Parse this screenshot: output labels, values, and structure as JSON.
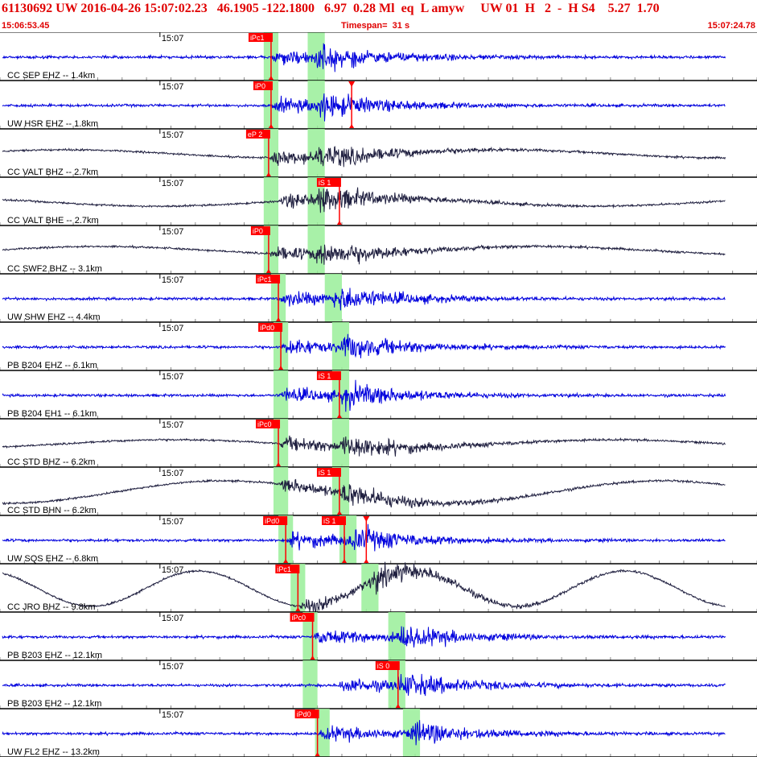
{
  "header": {
    "title": "61130692 UW 2016-04-26 15:07:02.23   46.1905 -122.1800   6.97  0.28 Ml  eq  L amyw     UW 01  H   2  -  H S4    5.27  1.70",
    "start_time": "15:06:53.45",
    "timespan_label": "Timespan=  31 s",
    "end_time": "15:07:24.78"
  },
  "colors": {
    "title": "#e00000",
    "pick_flag": "#ff0000",
    "pick_line": "#ff0000",
    "window_band": "#99ee99",
    "trace_vertical_velocity": "#0000dd",
    "trace_broadband": "#202040",
    "grid": "#d0d0d0",
    "panel_border": "#000000"
  },
  "chart_data": {
    "type": "line",
    "time_window": {
      "start": "15:06:53.45",
      "end": "15:07:24.78",
      "span_s": 31
    },
    "panel_time_label": "15:07",
    "panels": [
      {
        "label": "CC SEP EHZ -- 1.4km",
        "color": "trace_vertical_velocity",
        "picks": [
          {
            "label": "iPc1",
            "t": 11.1,
            "kind": "P"
          }
        ],
        "bands": [
          [
            10.8,
            11.4
          ],
          [
            12.6,
            13.3
          ]
        ]
      },
      {
        "label": "UW HSR EHZ -- 1.8km",
        "color": "trace_vertical_velocity",
        "picks": [
          {
            "label": "iP0",
            "t": 11.1,
            "kind": "P"
          },
          {
            "label": "",
            "t": 14.4,
            "kind": "S"
          }
        ],
        "bands": [
          [
            10.8,
            11.4
          ],
          [
            12.6,
            13.3
          ]
        ]
      },
      {
        "label": "CC VALT BHZ -- 2.7km",
        "color": "trace_broadband",
        "picks": [
          {
            "label": "eP 2",
            "t": 11.0,
            "kind": "P"
          }
        ],
        "bands": [
          [
            10.8,
            11.4
          ],
          [
            12.6,
            13.3
          ]
        ]
      },
      {
        "label": "CC VALT BHE -- 2.7km",
        "color": "trace_broadband",
        "picks": [
          {
            "label": "iS 1",
            "t": 13.9,
            "kind": "S"
          }
        ],
        "bands": [
          [
            10.8,
            11.4
          ],
          [
            12.6,
            13.3
          ]
        ]
      },
      {
        "label": "CC SWF2 BHZ -- 3.1km",
        "color": "trace_broadband",
        "picks": [
          {
            "label": "iP0",
            "t": 11.0,
            "kind": "P"
          }
        ],
        "bands": [
          [
            10.8,
            11.4
          ],
          [
            12.6,
            13.3
          ]
        ]
      },
      {
        "label": "UW SHW EHZ -- 4.4km",
        "color": "trace_vertical_velocity",
        "picks": [
          {
            "label": "iPc1",
            "t": 11.4,
            "kind": "P"
          }
        ],
        "bands": [
          [
            11.1,
            11.7
          ],
          [
            13.3,
            14.0
          ]
        ]
      },
      {
        "label": "PB B204 EHZ -- 6.1km",
        "color": "trace_vertical_velocity",
        "picks": [
          {
            "label": "iPd0",
            "t": 11.5,
            "kind": "P"
          }
        ],
        "bands": [
          [
            11.2,
            11.8
          ],
          [
            13.6,
            14.3
          ]
        ]
      },
      {
        "label": "PB B204 EH1 -- 6.1km",
        "color": "trace_vertical_velocity",
        "picks": [
          {
            "label": "iS 1",
            "t": 13.9,
            "kind": "S"
          }
        ],
        "bands": [
          [
            11.2,
            11.8
          ],
          [
            13.6,
            14.3
          ]
        ]
      },
      {
        "label": "CC STD BHZ -- 6.2km",
        "color": "trace_broadband",
        "picks": [
          {
            "label": "iPc0",
            "t": 11.4,
            "kind": "P"
          }
        ],
        "bands": [
          [
            11.2,
            11.8
          ],
          [
            13.6,
            14.3
          ]
        ]
      },
      {
        "label": "CC STD BHN -- 6.2km",
        "color": "trace_broadband",
        "picks": [
          {
            "label": "iS 1",
            "t": 13.9,
            "kind": "S"
          }
        ],
        "bands": [
          [
            11.2,
            11.8
          ],
          [
            13.6,
            14.3
          ]
        ]
      },
      {
        "label": "UW SQS EHZ -- 6.8km",
        "color": "trace_vertical_velocity",
        "picks": [
          {
            "label": "iPd0",
            "t": 11.7,
            "kind": "P"
          },
          {
            "label": "iS 1",
            "t": 14.1,
            "kind": "S"
          },
          {
            "label": "",
            "t": 15.0,
            "kind": "S"
          }
        ],
        "bands": [
          [
            11.4,
            12.0
          ],
          [
            13.9,
            14.6
          ]
        ]
      },
      {
        "label": "CC JRO BHZ -- 9.8km",
        "color": "trace_broadband",
        "picks": [
          {
            "label": "iPc1",
            "t": 12.2,
            "kind": "P"
          }
        ],
        "bands": [
          [
            11.9,
            12.5
          ],
          [
            14.8,
            15.5
          ]
        ]
      },
      {
        "label": "PB B203 EHZ -- 12.1km",
        "color": "trace_vertical_velocity",
        "picks": [
          {
            "label": "iPc0",
            "t": 12.8,
            "kind": "P"
          }
        ],
        "bands": [
          [
            12.4,
            13.0
          ],
          [
            15.9,
            16.6
          ]
        ]
      },
      {
        "label": "PB B203 EH2 -- 12.1km",
        "color": "trace_vertical_velocity",
        "picks": [
          {
            "label": "iS 0",
            "t": 16.3,
            "kind": "S"
          }
        ],
        "bands": [
          [
            12.4,
            13.0
          ],
          [
            15.9,
            16.6
          ]
        ]
      },
      {
        "label": "UW FL2 EHZ -- 13.2km",
        "color": "trace_vertical_velocity",
        "picks": [
          {
            "label": "iPd0",
            "t": 13.0,
            "kind": "P"
          }
        ],
        "bands": [
          [
            12.9,
            13.5
          ],
          [
            16.5,
            17.2
          ]
        ]
      }
    ]
  }
}
